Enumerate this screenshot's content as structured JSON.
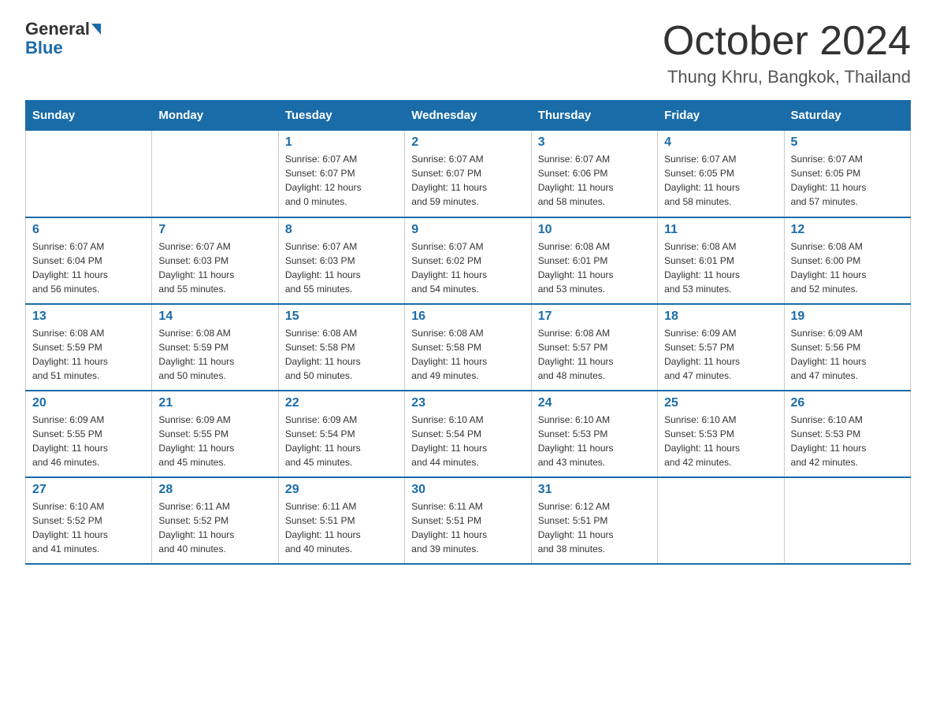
{
  "header": {
    "logo_general": "General",
    "logo_blue": "Blue",
    "month": "October 2024",
    "location": "Thung Khru, Bangkok, Thailand"
  },
  "days_of_week": [
    "Sunday",
    "Monday",
    "Tuesday",
    "Wednesday",
    "Thursday",
    "Friday",
    "Saturday"
  ],
  "weeks": [
    [
      {
        "day": "",
        "info": ""
      },
      {
        "day": "",
        "info": ""
      },
      {
        "day": "1",
        "info": "Sunrise: 6:07 AM\nSunset: 6:07 PM\nDaylight: 12 hours\nand 0 minutes."
      },
      {
        "day": "2",
        "info": "Sunrise: 6:07 AM\nSunset: 6:07 PM\nDaylight: 11 hours\nand 59 minutes."
      },
      {
        "day": "3",
        "info": "Sunrise: 6:07 AM\nSunset: 6:06 PM\nDaylight: 11 hours\nand 58 minutes."
      },
      {
        "day": "4",
        "info": "Sunrise: 6:07 AM\nSunset: 6:05 PM\nDaylight: 11 hours\nand 58 minutes."
      },
      {
        "day": "5",
        "info": "Sunrise: 6:07 AM\nSunset: 6:05 PM\nDaylight: 11 hours\nand 57 minutes."
      }
    ],
    [
      {
        "day": "6",
        "info": "Sunrise: 6:07 AM\nSunset: 6:04 PM\nDaylight: 11 hours\nand 56 minutes."
      },
      {
        "day": "7",
        "info": "Sunrise: 6:07 AM\nSunset: 6:03 PM\nDaylight: 11 hours\nand 55 minutes."
      },
      {
        "day": "8",
        "info": "Sunrise: 6:07 AM\nSunset: 6:03 PM\nDaylight: 11 hours\nand 55 minutes."
      },
      {
        "day": "9",
        "info": "Sunrise: 6:07 AM\nSunset: 6:02 PM\nDaylight: 11 hours\nand 54 minutes."
      },
      {
        "day": "10",
        "info": "Sunrise: 6:08 AM\nSunset: 6:01 PM\nDaylight: 11 hours\nand 53 minutes."
      },
      {
        "day": "11",
        "info": "Sunrise: 6:08 AM\nSunset: 6:01 PM\nDaylight: 11 hours\nand 53 minutes."
      },
      {
        "day": "12",
        "info": "Sunrise: 6:08 AM\nSunset: 6:00 PM\nDaylight: 11 hours\nand 52 minutes."
      }
    ],
    [
      {
        "day": "13",
        "info": "Sunrise: 6:08 AM\nSunset: 5:59 PM\nDaylight: 11 hours\nand 51 minutes."
      },
      {
        "day": "14",
        "info": "Sunrise: 6:08 AM\nSunset: 5:59 PM\nDaylight: 11 hours\nand 50 minutes."
      },
      {
        "day": "15",
        "info": "Sunrise: 6:08 AM\nSunset: 5:58 PM\nDaylight: 11 hours\nand 50 minutes."
      },
      {
        "day": "16",
        "info": "Sunrise: 6:08 AM\nSunset: 5:58 PM\nDaylight: 11 hours\nand 49 minutes."
      },
      {
        "day": "17",
        "info": "Sunrise: 6:08 AM\nSunset: 5:57 PM\nDaylight: 11 hours\nand 48 minutes."
      },
      {
        "day": "18",
        "info": "Sunrise: 6:09 AM\nSunset: 5:57 PM\nDaylight: 11 hours\nand 47 minutes."
      },
      {
        "day": "19",
        "info": "Sunrise: 6:09 AM\nSunset: 5:56 PM\nDaylight: 11 hours\nand 47 minutes."
      }
    ],
    [
      {
        "day": "20",
        "info": "Sunrise: 6:09 AM\nSunset: 5:55 PM\nDaylight: 11 hours\nand 46 minutes."
      },
      {
        "day": "21",
        "info": "Sunrise: 6:09 AM\nSunset: 5:55 PM\nDaylight: 11 hours\nand 45 minutes."
      },
      {
        "day": "22",
        "info": "Sunrise: 6:09 AM\nSunset: 5:54 PM\nDaylight: 11 hours\nand 45 minutes."
      },
      {
        "day": "23",
        "info": "Sunrise: 6:10 AM\nSunset: 5:54 PM\nDaylight: 11 hours\nand 44 minutes."
      },
      {
        "day": "24",
        "info": "Sunrise: 6:10 AM\nSunset: 5:53 PM\nDaylight: 11 hours\nand 43 minutes."
      },
      {
        "day": "25",
        "info": "Sunrise: 6:10 AM\nSunset: 5:53 PM\nDaylight: 11 hours\nand 42 minutes."
      },
      {
        "day": "26",
        "info": "Sunrise: 6:10 AM\nSunset: 5:53 PM\nDaylight: 11 hours\nand 42 minutes."
      }
    ],
    [
      {
        "day": "27",
        "info": "Sunrise: 6:10 AM\nSunset: 5:52 PM\nDaylight: 11 hours\nand 41 minutes."
      },
      {
        "day": "28",
        "info": "Sunrise: 6:11 AM\nSunset: 5:52 PM\nDaylight: 11 hours\nand 40 minutes."
      },
      {
        "day": "29",
        "info": "Sunrise: 6:11 AM\nSunset: 5:51 PM\nDaylight: 11 hours\nand 40 minutes."
      },
      {
        "day": "30",
        "info": "Sunrise: 6:11 AM\nSunset: 5:51 PM\nDaylight: 11 hours\nand 39 minutes."
      },
      {
        "day": "31",
        "info": "Sunrise: 6:12 AM\nSunset: 5:51 PM\nDaylight: 11 hours\nand 38 minutes."
      },
      {
        "day": "",
        "info": ""
      },
      {
        "day": "",
        "info": ""
      }
    ]
  ]
}
